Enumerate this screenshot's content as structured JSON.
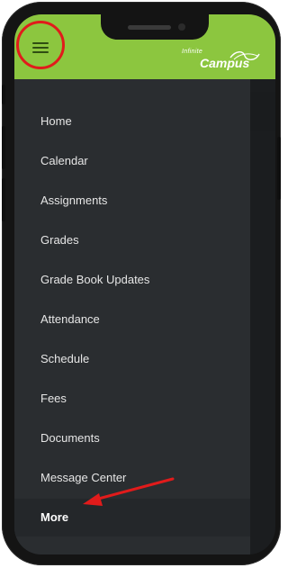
{
  "app": {
    "logo_line1": "Infinite",
    "logo_line2": "Campus"
  },
  "menu": {
    "items": [
      {
        "label": "Home"
      },
      {
        "label": "Calendar"
      },
      {
        "label": "Assignments"
      },
      {
        "label": "Grades"
      },
      {
        "label": "Grade Book Updates"
      },
      {
        "label": "Attendance"
      },
      {
        "label": "Schedule"
      },
      {
        "label": "Fees"
      },
      {
        "label": "Documents"
      },
      {
        "label": "Message Center"
      },
      {
        "label": "More"
      }
    ],
    "active_index": 10
  },
  "annotations": {
    "circle_color": "#e11b1b",
    "arrow_color": "#e11b1b"
  },
  "theme": {
    "header_bg": "#8cc63f",
    "menu_bg": "#2a2d30",
    "text_color": "#e6e6e6"
  },
  "icons": {
    "menu": "hamburger-icon",
    "logo": "infinite-campus-logo"
  }
}
